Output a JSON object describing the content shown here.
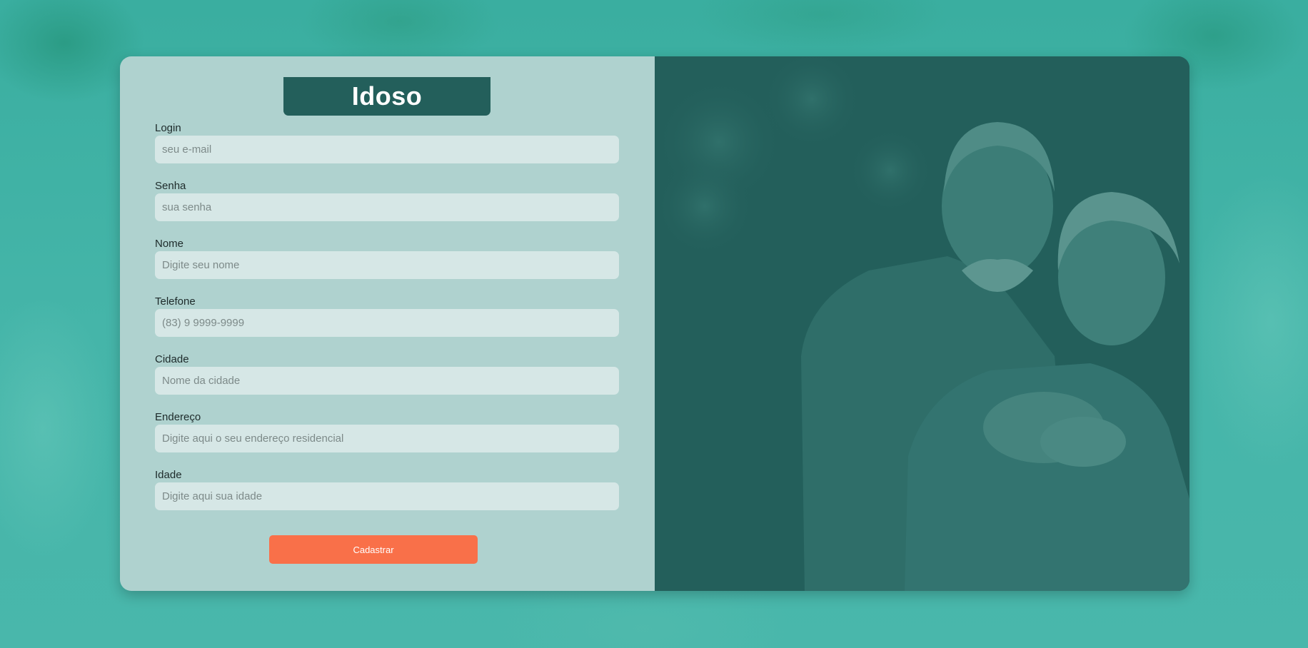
{
  "form": {
    "title": "Idoso",
    "fields": [
      {
        "label": "Login",
        "placeholder": "seu e-mail"
      },
      {
        "label": "Senha",
        "placeholder": "sua senha"
      },
      {
        "label": "Nome",
        "placeholder": "Digite seu nome"
      },
      {
        "label": "Telefone",
        "placeholder": "(83) 9 9999-9999"
      },
      {
        "label": "Cidade",
        "placeholder": "Nome da cidade"
      },
      {
        "label": "Endereço",
        "placeholder": "Digite aqui o seu endereço residencial"
      },
      {
        "label": "Idade",
        "placeholder": "Digite aqui sua idade"
      }
    ],
    "submit_label": "Cadastrar"
  },
  "colors": {
    "panel_bg": "#afd2cf",
    "title_bg": "#235f5b",
    "input_bg": "#d6e7e6",
    "button_bg": "#f97049",
    "page_bg": "#45b5a9"
  }
}
